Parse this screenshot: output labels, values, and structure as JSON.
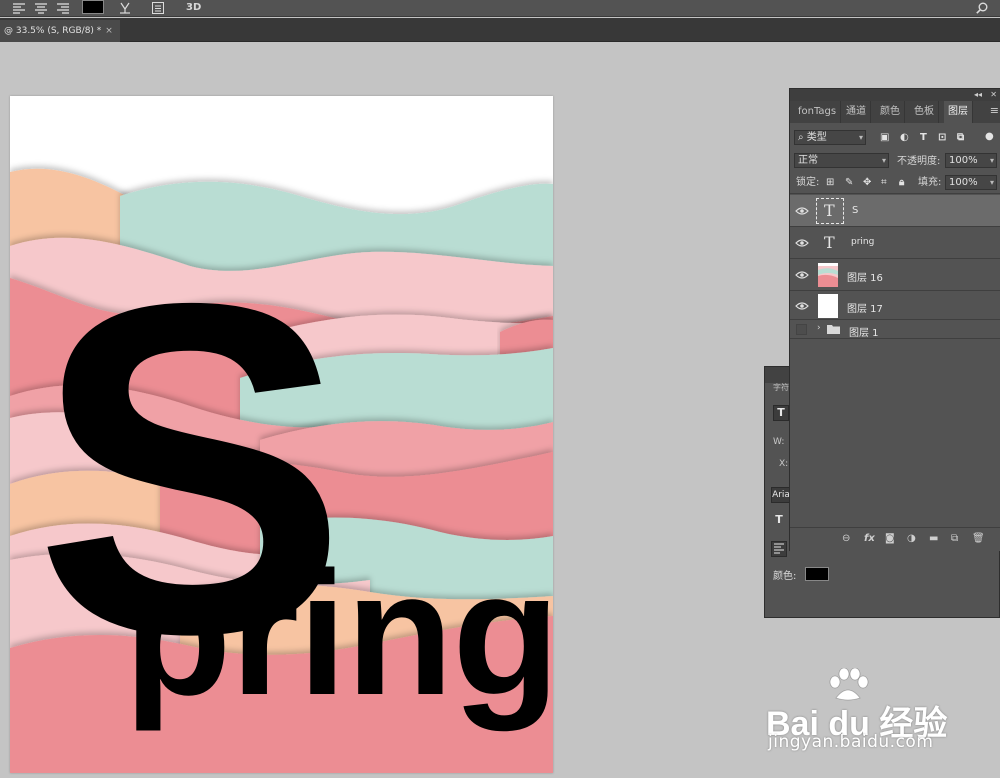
{
  "options_bar": {
    "mode_3d_label": "3D"
  },
  "document": {
    "tab_title": "@ 33.5% (S, RGB/8) *",
    "close": "×"
  },
  "canvas": {
    "big_letter": "S",
    "word": "pring"
  },
  "layers_panel": {
    "tabs": [
      "fonTags",
      "通道",
      "颜色",
      "色板",
      "图层"
    ],
    "active_tab": "图层",
    "filter": {
      "kind_label": "类型"
    },
    "blend_mode": "正常",
    "opacity": {
      "label": "不透明度:",
      "value": "100%"
    },
    "lock": {
      "label": "锁定:"
    },
    "fill": {
      "label": "填充:",
      "value": "100%"
    },
    "layers": [
      {
        "name": "S",
        "type": "text",
        "visible": true,
        "selected": true
      },
      {
        "name": "pring",
        "type": "text",
        "visible": true,
        "selected": false
      },
      {
        "name": "图层 16",
        "type": "image",
        "visible": true,
        "selected": false
      },
      {
        "name": "图层 17",
        "type": "image",
        "visible": true,
        "selected": false
      },
      {
        "name": "图层 1",
        "type": "group",
        "visible": false,
        "selected": false
      }
    ],
    "bottom_icons": [
      "link-icon",
      "fx-icon",
      "mask-icon",
      "adjustment-icon",
      "folder-icon",
      "new-layer-icon",
      "trash-icon"
    ]
  },
  "character_panel": {
    "tab_label": "字符",
    "w_label": "W:",
    "x_label": "X:",
    "font_field": "Aria",
    "color_label": "颜色:",
    "color_value": "#000000"
  },
  "watermark": {
    "logo": "Bai du 经验",
    "url": "jingyan.baidu.com"
  },
  "colors": {
    "ui_dark": "#535353",
    "ui_darker": "#383838",
    "workspace": "#c4c4c4",
    "mint": "#b9ddd3",
    "peach": "#f7c4a2",
    "pink_light": "#f6c8cb",
    "pink": "#f0a1a6",
    "coral": "#ec8d93"
  }
}
